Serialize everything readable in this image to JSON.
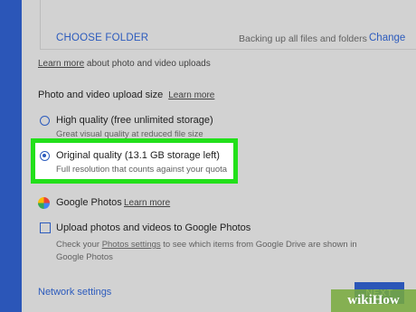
{
  "folder": {
    "choose_label": "CHOOSE FOLDER",
    "status": "Backing up all files and folders",
    "change_label": "Change"
  },
  "uploads_info": {
    "link": "Learn more",
    "text": " about photo and video uploads"
  },
  "upload_size": {
    "heading": "Photo and video upload size",
    "learn_more": "Learn more",
    "options": [
      {
        "label": "High quality (free unlimited storage)",
        "description": "Great visual quality at reduced file size",
        "selected": false
      },
      {
        "label": "Original quality (13.1 GB storage left)",
        "description": "Full resolution that counts against your quota",
        "selected": true
      }
    ]
  },
  "google_photos": {
    "icon": "google-photos-pinwheel-icon",
    "title": "Google Photos",
    "learn_more": "Learn more",
    "checkbox_label": "Upload photos and videos to Google Photos",
    "checkbox_checked": false,
    "desc_prefix": "Check your ",
    "desc_link": "Photos settings",
    "desc_suffix": " to see which items from Google Drive are shown in Google Photos"
  },
  "footer": {
    "network_settings": "Network settings",
    "next_label": "NEXT"
  },
  "watermark": "wikiHow",
  "colors": {
    "accent": "#2c5bbd",
    "highlight": "#22e01a",
    "sidebar": "#2b56b8"
  }
}
